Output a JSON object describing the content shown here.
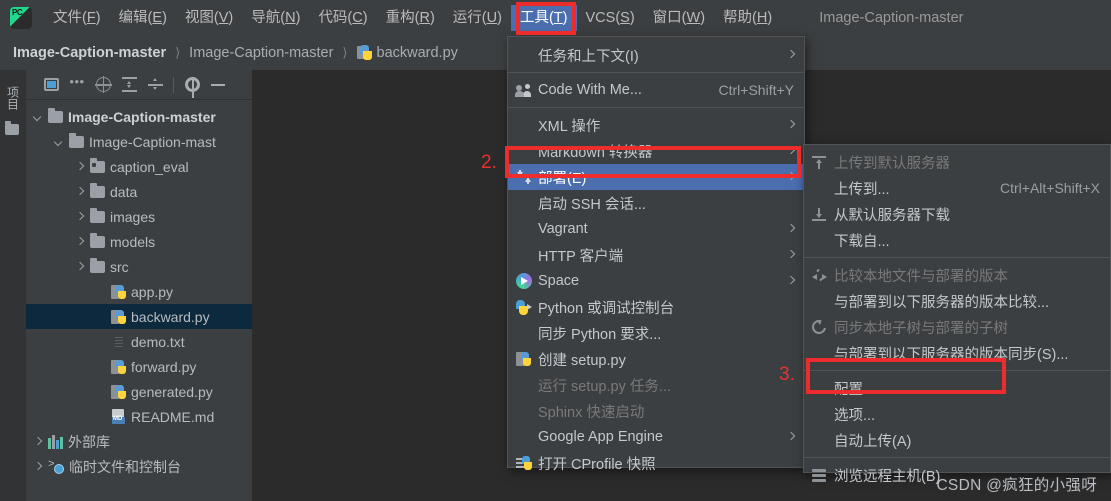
{
  "window": {
    "title": "Image-Caption-master",
    "logo": "pycharm-logo"
  },
  "menubar": {
    "items": [
      {
        "label": "文件(F)",
        "mnemonic": "F",
        "active": false
      },
      {
        "label": "编辑(E)",
        "mnemonic": "E",
        "active": false
      },
      {
        "label": "视图(V)",
        "mnemonic": "V",
        "active": false
      },
      {
        "label": "导航(N)",
        "mnemonic": "N",
        "active": false
      },
      {
        "label": "代码(C)",
        "mnemonic": "C",
        "active": false
      },
      {
        "label": "重构(R)",
        "mnemonic": "R",
        "active": false
      },
      {
        "label": "运行(U)",
        "mnemonic": "U",
        "active": false
      },
      {
        "label": "工具(T)",
        "mnemonic": "T",
        "active": true
      },
      {
        "label": "VCS(S)",
        "mnemonic": "S",
        "active": false
      },
      {
        "label": "窗口(W)",
        "mnemonic": "W",
        "active": false
      },
      {
        "label": "帮助(H)",
        "mnemonic": "H",
        "active": false
      }
    ]
  },
  "breadcrumb": {
    "items": [
      {
        "label": "Image-Caption-master",
        "bold": true,
        "icon": null
      },
      {
        "label": "Image-Caption-master",
        "bold": false,
        "icon": null
      },
      {
        "label": "backward.py",
        "bold": false,
        "icon": "python-file-icon"
      }
    ],
    "separator": "〉"
  },
  "tool_strip": {
    "project_tab_label": "项目",
    "folder_icon": "folder-icon"
  },
  "project_panel": {
    "toolbar": [
      {
        "name": "select-opened-file-icon",
        "label": ""
      },
      {
        "name": "more-options-icon",
        "label": "..."
      },
      {
        "name": "locate-target-icon",
        "label": ""
      },
      {
        "name": "expand-all-icon",
        "label": ""
      },
      {
        "name": "collapse-all-icon",
        "label": ""
      },
      {
        "name": "settings-gear-icon",
        "label": ""
      },
      {
        "name": "hide-panel-icon",
        "label": ""
      }
    ],
    "tree": [
      {
        "label": "Image-Caption-master",
        "depth": 0,
        "arrow": "down",
        "icon": "folder-icon",
        "bold": true,
        "selected": false
      },
      {
        "label": "Image-Caption-mast",
        "depth": 1,
        "arrow": "down",
        "icon": "folder-icon",
        "bold": false,
        "selected": false
      },
      {
        "label": "caption_eval",
        "depth": 2,
        "arrow": "right",
        "icon": "folder-src-icon",
        "bold": false,
        "selected": false
      },
      {
        "label": "data",
        "depth": 2,
        "arrow": "right",
        "icon": "folder-icon",
        "bold": false,
        "selected": false
      },
      {
        "label": "images",
        "depth": 2,
        "arrow": "right",
        "icon": "folder-icon",
        "bold": false,
        "selected": false
      },
      {
        "label": "models",
        "depth": 2,
        "arrow": "right",
        "icon": "folder-icon",
        "bold": false,
        "selected": false
      },
      {
        "label": "src",
        "depth": 2,
        "arrow": "right",
        "icon": "folder-icon",
        "bold": false,
        "selected": false
      },
      {
        "label": "app.py",
        "depth": 3,
        "arrow": "none",
        "icon": "python-file-icon",
        "bold": false,
        "selected": false
      },
      {
        "label": "backward.py",
        "depth": 3,
        "arrow": "none",
        "icon": "python-file-icon",
        "bold": false,
        "selected": true
      },
      {
        "label": "demo.txt",
        "depth": 3,
        "arrow": "none",
        "icon": "text-file-icon",
        "bold": false,
        "selected": false
      },
      {
        "label": "forward.py",
        "depth": 3,
        "arrow": "none",
        "icon": "python-file-icon",
        "bold": false,
        "selected": false
      },
      {
        "label": "generated.py",
        "depth": 3,
        "arrow": "none",
        "icon": "python-file-icon",
        "bold": false,
        "selected": false
      },
      {
        "label": "README.md",
        "depth": 3,
        "arrow": "none",
        "icon": "markdown-file-icon",
        "bold": false,
        "selected": false
      },
      {
        "label": "外部库",
        "depth": 0,
        "arrow": "right",
        "icon": "library-icon",
        "bold": false,
        "selected": false
      },
      {
        "label": "临时文件和控制台",
        "depth": 0,
        "arrow": "right",
        "icon": "scratches-icon",
        "bold": false,
        "selected": false
      }
    ]
  },
  "tools_menu": {
    "items": [
      {
        "label": "任务和上下文(I)",
        "icon": null,
        "accel": "",
        "submenu": true,
        "disabled": false,
        "selected": false,
        "separator_after": true
      },
      {
        "label": "Code With Me...",
        "icon": "people-icon",
        "accel": "Ctrl+Shift+Y",
        "submenu": false,
        "disabled": false,
        "selected": false,
        "separator_after": true
      },
      {
        "label": "XML 操作",
        "icon": null,
        "accel": "",
        "submenu": true,
        "disabled": false,
        "selected": false,
        "separator_after": false
      },
      {
        "label": "Markdown 转换器",
        "icon": null,
        "accel": "",
        "submenu": true,
        "disabled": false,
        "selected": false,
        "separator_after": false
      },
      {
        "label": "部署(E)",
        "icon": "deploy-icon",
        "accel": "",
        "submenu": true,
        "disabled": false,
        "selected": true,
        "separator_after": false
      },
      {
        "label": "启动 SSH 会话...",
        "icon": null,
        "accel": "",
        "submenu": false,
        "disabled": false,
        "selected": false,
        "separator_after": false
      },
      {
        "label": "Vagrant",
        "icon": null,
        "accel": "",
        "submenu": true,
        "disabled": false,
        "selected": false,
        "separator_after": false
      },
      {
        "label": "HTTP 客户端",
        "icon": null,
        "accel": "",
        "submenu": true,
        "disabled": false,
        "selected": false,
        "separator_after": false
      },
      {
        "label": "Space",
        "icon": "space-icon",
        "accel": "",
        "submenu": true,
        "disabled": false,
        "selected": false,
        "separator_after": false
      },
      {
        "label": "Python 或调试控制台",
        "icon": "py-console-icon",
        "accel": "",
        "submenu": false,
        "disabled": false,
        "selected": false,
        "separator_after": false
      },
      {
        "label": "同步 Python 要求...",
        "icon": null,
        "accel": "",
        "submenu": false,
        "disabled": false,
        "selected": false,
        "separator_after": false
      },
      {
        "label": "创建 setup.py",
        "icon": "py-file-icon",
        "accel": "",
        "submenu": false,
        "disabled": false,
        "selected": false,
        "separator_after": false
      },
      {
        "label": "运行 setup.py 任务...",
        "icon": null,
        "accel": "",
        "submenu": false,
        "disabled": true,
        "selected": false,
        "separator_after": false
      },
      {
        "label": "Sphinx 快速启动",
        "icon": null,
        "accel": "",
        "submenu": false,
        "disabled": true,
        "selected": false,
        "separator_after": false
      },
      {
        "label": "Google App Engine",
        "icon": null,
        "accel": "",
        "submenu": true,
        "disabled": false,
        "selected": false,
        "separator_after": false
      },
      {
        "label": "打开 CProfile 快照",
        "icon": "cprofile-icon",
        "accel": "",
        "submenu": false,
        "disabled": false,
        "selected": false,
        "separator_after": false
      }
    ]
  },
  "deploy_submenu": {
    "items": [
      {
        "label": "上传到默认服务器",
        "icon": "upload-icon",
        "accel": "",
        "disabled": true,
        "separator_after": false
      },
      {
        "label": "上传到...",
        "icon": null,
        "accel": "Ctrl+Alt+Shift+X",
        "disabled": false,
        "separator_after": false
      },
      {
        "label": "从默认服务器下载",
        "icon": "download-icon",
        "accel": "",
        "disabled": false,
        "separator_after": false
      },
      {
        "label": "下载自...",
        "icon": null,
        "accel": "",
        "disabled": false,
        "separator_after": true
      },
      {
        "label": "比较本地文件与部署的版本",
        "icon": "compare-icon",
        "accel": "",
        "disabled": true,
        "separator_after": false
      },
      {
        "label": "与部署到以下服务器的版本比较...",
        "icon": null,
        "accel": "",
        "disabled": false,
        "separator_after": false
      },
      {
        "label": "同步本地子树与部署的子树",
        "icon": "sync-icon",
        "accel": "",
        "disabled": true,
        "separator_after": false
      },
      {
        "label": "与部署到以下服务器的版本同步(S)...",
        "icon": null,
        "accel": "",
        "disabled": false,
        "separator_after": true
      },
      {
        "label": "配置...",
        "icon": null,
        "accel": "",
        "disabled": false,
        "separator_after": false
      },
      {
        "label": "选项...",
        "icon": null,
        "accel": "",
        "disabled": false,
        "separator_after": false
      },
      {
        "label": "自动上传(A)",
        "icon": null,
        "accel": "",
        "disabled": false,
        "separator_after": true
      },
      {
        "label": "浏览远程主机(B)",
        "icon": "browse-icon",
        "accel": "",
        "disabled": false,
        "separator_after": false
      }
    ]
  },
  "annotations": {
    "color": "#ef2c2c",
    "markers": [
      {
        "label": "2.",
        "target": "deploy-menu-item"
      },
      {
        "label": "3.",
        "target": "configure-menu-item"
      }
    ]
  },
  "watermark": "CSDN @疯狂的小强呀"
}
